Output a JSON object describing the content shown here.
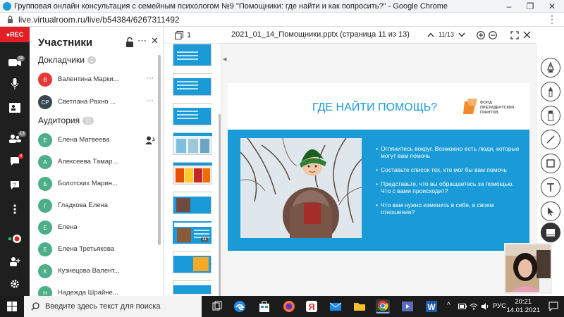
{
  "browser": {
    "title": "Групповая онлайн консультация с семейным психологом №9 \"Помощники: где найти и как попросить?\" - Google Chrome",
    "url": "live.virtualroom.ru/live/b54384/6267311492",
    "minimize": "–",
    "restore": "❐",
    "close": "✕",
    "menu": "⋮"
  },
  "leftbar": {
    "rec_label": "REC",
    "cam_badge": "48",
    "people_badge": "13",
    "chat_badge": "4"
  },
  "participants": {
    "title": "Участники",
    "speakers_label": "Докладчики",
    "speakers_count": "2",
    "speakers": [
      {
        "initials": "В",
        "name": "Валентина Марки...",
        "color": "#e53935"
      },
      {
        "initials": "СР",
        "name": "Светлана Рахно ...",
        "color": "#37474f"
      }
    ],
    "audience_label": "Аудитория",
    "audience_count": "11",
    "audience": [
      {
        "initials": "Е",
        "name": "Елена Матвеева"
      },
      {
        "initials": "А",
        "name": "Алексеева Тамар..."
      },
      {
        "initials": "Б",
        "name": "Болотских Марин..."
      },
      {
        "initials": "Г",
        "name": "Гладкова Елена"
      },
      {
        "initials": "Е",
        "name": "Елена"
      },
      {
        "initials": "Е",
        "name": "Елена Третьякова"
      },
      {
        "initials": "К",
        "name": "Кузнецова Валент..."
      },
      {
        "initials": "Н",
        "name": "Надежда Шрайне..."
      }
    ],
    "audience_color": "#4caf8a"
  },
  "document": {
    "page_index": "1",
    "filename": "2021_01_14_Помощники.pptx (страница 11 из 13)",
    "page_counter": "11/13",
    "current_thumb_number": "11"
  },
  "slide": {
    "title": "ГДЕ НАЙТИ ПОМОЩЬ?",
    "logo_text": "ФОНД\nПРЕЗИДЕНТСКИХ\nГРАНТОВ",
    "bullets": [
      "Оглянитесь вокруг. Возможно есть люди, которые могут вам помочь",
      "Составьте список тех, кто мог бы вам помочь",
      "Представьте, что вы обращаетесь за помощью. Что с вами происходит?",
      "Что вам нужно изменить в себе, в своем отношении?"
    ]
  },
  "taskbar": {
    "search_placeholder": "Введите здесь текст для поиска",
    "lang": "РУС",
    "time": "20:21",
    "date": "14.01.2021"
  }
}
